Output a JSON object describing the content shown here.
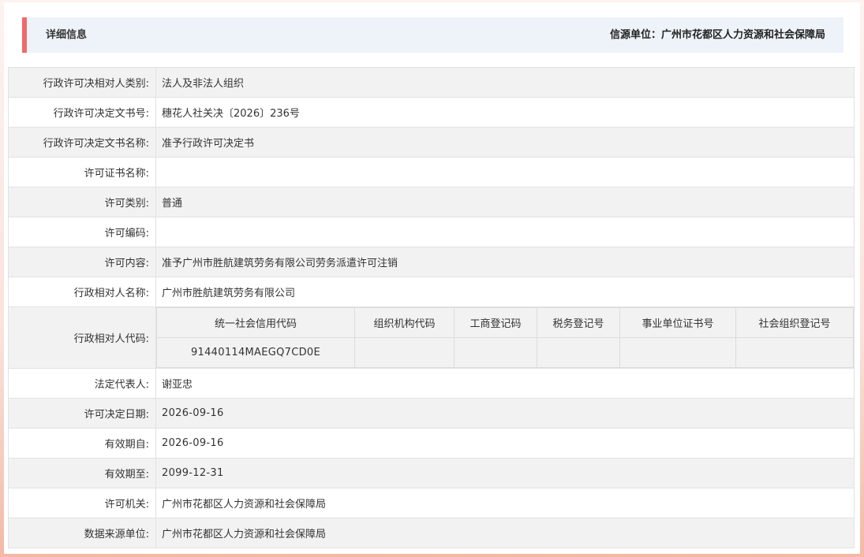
{
  "header": {
    "title": "详细信息",
    "source_label": "信源单位：广州市花都区人力资源和社会保障局"
  },
  "rows": [
    {
      "label": "行政许可决相对人类别:",
      "value": "法人及非法人组织"
    },
    {
      "label": "行政许可决定文书号:",
      "value": "穗花人社关决〔2026〕236号"
    },
    {
      "label": "行政许可决定文书名称:",
      "value": "准予行政许可决定书"
    },
    {
      "label": "许可证书名称:",
      "value": ""
    },
    {
      "label": "许可类别:",
      "value": "普通"
    },
    {
      "label": "许可编码:",
      "value": ""
    },
    {
      "label": "许可内容:",
      "value": "准予广州市胜航建筑劳务有限公司劳务派遣许可注销"
    },
    {
      "label": "行政相对人名称:",
      "value": "广州市胜航建筑劳务有限公司"
    }
  ],
  "codes": {
    "label": "行政相对人代码:",
    "headers": [
      "统一社会信用代码",
      "组织机构代码",
      "工商登记码",
      "税务登记号",
      "事业单位证书号",
      "社会组织登记号"
    ],
    "values": [
      "91440114MAEGQ7CD0E",
      "",
      "",
      "",
      "",
      ""
    ]
  },
  "rows2": [
    {
      "label": "法定代表人:",
      "value": "谢亚忠"
    },
    {
      "label": "许可决定日期:",
      "value": "2026-09-16"
    },
    {
      "label": "有效期自:",
      "value": "2026-09-16"
    },
    {
      "label": "有效期至:",
      "value": "2099-12-31"
    },
    {
      "label": "许可机关:",
      "value": "广州市花都区人力资源和社会保障局"
    },
    {
      "label": "数据来源单位:",
      "value": "广州市花都区人力资源和社会保障局"
    }
  ],
  "colors": {
    "accent_bar": "#ef6a6a",
    "header_bg": "#eef3fa",
    "row_alt": "#f2f2f2"
  }
}
